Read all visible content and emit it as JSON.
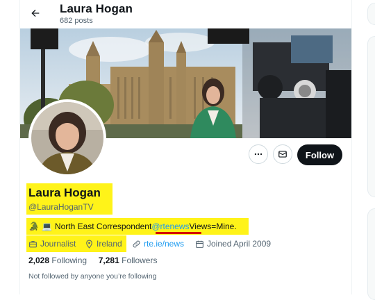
{
  "header": {
    "name": "Laura Hogan",
    "posts": "682 posts"
  },
  "profile": {
    "name": "Laura Hogan",
    "handle": "@LauraHoganTV",
    "bio_emoji_1": "🐊",
    "bio_emoji_2": "💻",
    "bio_text_before": "North East Correspondent ",
    "bio_mention": "@rtenews",
    "bio_text_after": " Views=Mine.",
    "profession": "Journalist",
    "location": "Ireland",
    "website": "rte.ie/news",
    "joined": "Joined April 2009",
    "following_count": "2,028",
    "following_label": "Following",
    "followers_count": "7,281",
    "followers_label": "Followers",
    "followed_note": "Not followed by anyone you’re following"
  },
  "actions": {
    "follow_label": "Follow"
  },
  "colors": {
    "highlight": "#fff200",
    "underline": "#d40000",
    "link": "#1d9bf0",
    "follow_bg": "#0f1419"
  }
}
